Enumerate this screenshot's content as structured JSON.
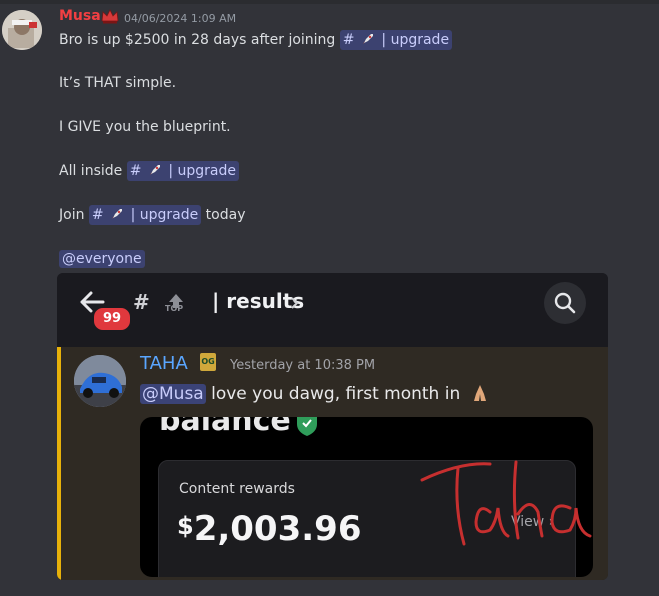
{
  "message": {
    "author": "Musa",
    "timestamp": "04/06/2024 1:09 AM",
    "lines": [
      {
        "text": "Bro is up $2500 in 28 days after joining",
        "channel": "| upgrade"
      },
      {
        "text": "It’s THAT simple."
      },
      {
        "text": "I GIVE you the blueprint."
      },
      {
        "text": "All inside",
        "channel": "| upgrade"
      },
      {
        "text_before": "Join",
        "channel": "| upgrade",
        "text_after": "today"
      },
      {
        "mention": "@everyone"
      }
    ]
  },
  "embed": {
    "unread_badge": "99",
    "top_label": "TOP",
    "channel_title": "| results",
    "quoted": {
      "author": "TAHA",
      "badge": "OG",
      "time": "Yesterday at 10:38 PM",
      "mention": "@Musa",
      "text": "love you dawg, first month in"
    },
    "card": {
      "heading": "balance",
      "label": "Content rewards",
      "currency": "$",
      "amount": "2,003.96",
      "link": "View ›"
    }
  },
  "colors": {
    "author": "#f23f42",
    "mention_bg": "#3c4270",
    "quote_bar": "#e7b10a",
    "badge": "#e0383d"
  }
}
